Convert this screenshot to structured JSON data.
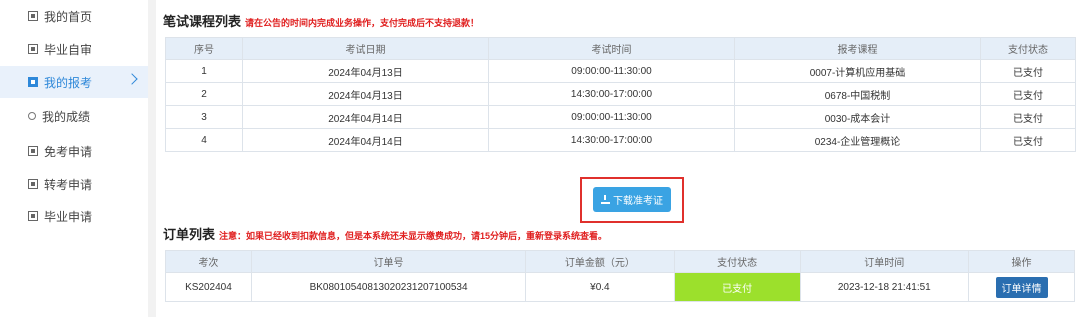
{
  "sidebar": {
    "items": [
      {
        "label": "我的首页",
        "icon": "home-icon"
      },
      {
        "label": "毕业自审",
        "icon": "review-icon"
      },
      {
        "label": "我的报考",
        "icon": "exam-icon",
        "active": true
      },
      {
        "label": "我的成绩",
        "icon": "user-icon"
      },
      {
        "label": "免考申请",
        "icon": "exempt-icon"
      },
      {
        "label": "转考申请",
        "icon": "transfer-icon"
      },
      {
        "label": "毕业申请",
        "icon": "graduation-icon"
      }
    ]
  },
  "exam_section": {
    "title": "笔试课程列表",
    "note": "请在公告的时间内完成业务操作，支付完成后不支持退款！",
    "columns": [
      "序号",
      "考试日期",
      "考试时间",
      "报考课程",
      "支付状态"
    ],
    "rows": [
      [
        "1",
        "2024年04月13日",
        "09:00:00-11:30:00",
        "0007-计算机应用基础",
        "已支付"
      ],
      [
        "2",
        "2024年04月13日",
        "14:30:00-17:00:00",
        "0678-中国税制",
        "已支付"
      ],
      [
        "3",
        "2024年04月14日",
        "09:00:00-11:30:00",
        "0030-成本会计",
        "已支付"
      ],
      [
        "4",
        "2024年04月14日",
        "14:30:00-17:00:00",
        "0234-企业管理概论",
        "已支付"
      ]
    ]
  },
  "download_button": {
    "label": "下载准考证"
  },
  "order_section": {
    "title": "订单列表",
    "note": "注意：如果已经收到扣款信息，但是本系统还未显示缴费成功，请15分钟后，重新登录系统查看。",
    "columns": [
      "考次",
      "订单号",
      "订单金额（元）",
      "支付状态",
      "订单时间",
      "操作"
    ],
    "rows": [
      {
        "term": "KS202404",
        "order_no": "BK0801054081302023120710053​4",
        "amount": "¥0.4",
        "status": "已支付",
        "time": "2023-12-18 21:41:51",
        "action": "订单详情"
      }
    ]
  },
  "colors": {
    "accent": "#2e88d9",
    "paid": "#9ce02c",
    "warning": "#e02020",
    "highlight": "#e0302c"
  }
}
